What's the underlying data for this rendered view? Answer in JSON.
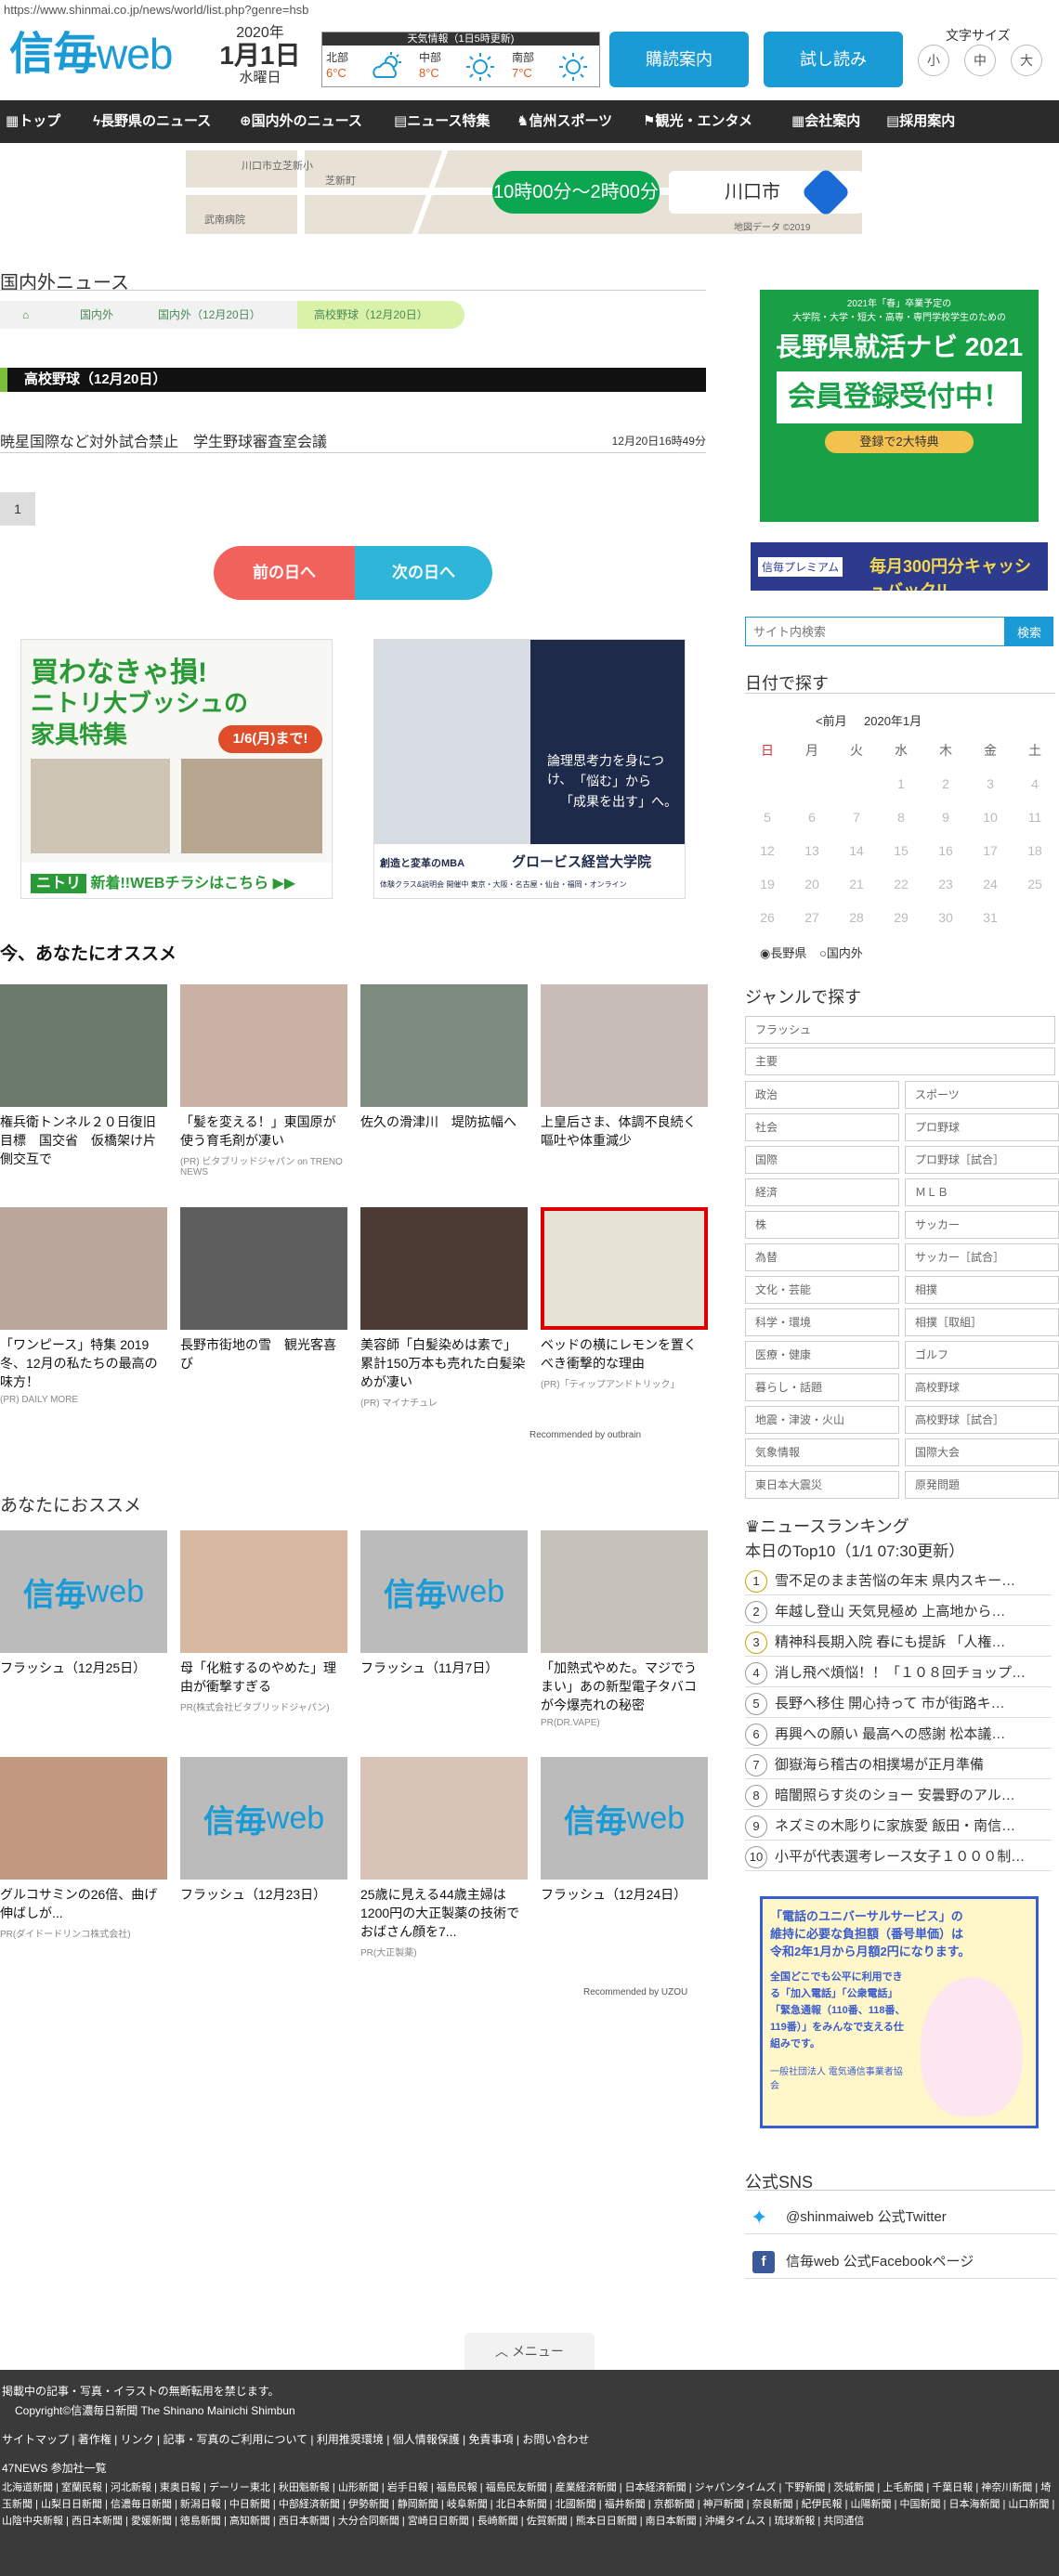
{
  "url": "https://www.shinmai.co.jp/news/world/list.php?genre=hsb",
  "logo": {
    "main": "信毎",
    "sub": "web"
  },
  "date": {
    "year": "2020年",
    "day": "1月1日",
    "weekday": "水曜日"
  },
  "weather": {
    "title": "天気情報（1日5時更新)",
    "areas": [
      {
        "name": "北部",
        "temp": "6°C",
        "icon": "cloud-sun-icon"
      },
      {
        "name": "中部",
        "temp": "8°C",
        "icon": "sun-icon"
      },
      {
        "name": "南部",
        "temp": "7°C",
        "icon": "sun-icon"
      }
    ]
  },
  "header_buttons": {
    "subscribe": "購読案内",
    "trial": "試し読み"
  },
  "font_size": {
    "label": "文字サイズ",
    "small": "小",
    "medium": "中",
    "large": "大"
  },
  "nav": [
    "トップ",
    "長野県のニュース",
    "国内外のニュース",
    "ニュース特集",
    "信州スポーツ",
    "観光・エンタメ",
    "会社案内",
    "採用案内"
  ],
  "map_ad": {
    "time": "10時00分～2時00分",
    "city": "川口市",
    "credit": "地図データ ©2019",
    "label1": "川口市立芝新小",
    "label2": "芝新町",
    "label3": "武南病院"
  },
  "section_title": "国内外ニュース",
  "breadcrumb": [
    "国内外",
    "国内外（12月20日）",
    "高校野球（12月20日）"
  ],
  "category": "高校野球（12月20日）",
  "news": [
    {
      "title": "暁星国際など対外試合禁止　学生野球審査室会議",
      "time": "12月20日16時49分"
    }
  ],
  "page": "1",
  "day_nav": {
    "prev": "前の日へ",
    "next": "次の日へ"
  },
  "ads": {
    "nitori": {
      "title": "買わなきゃ損!",
      "title2": "ニトリ大ブッシュの",
      "title3": "家具特集",
      "until": "1/6(月)まで!",
      "brand": "ニトリ",
      "footer": "新着!!WEBチラシはこちら ▶▶"
    },
    "globis": {
      "copy1": "論理思考力を身につけ、",
      "copy2": "「悩む」から",
      "copy3": "「成果を出す」へ。",
      "brand": "グロービス経営大学院",
      "tag": "創造と変革のMBA",
      "footer": "体験クラス&説明会 開催中 東京・大阪・名古屋・仙台・福岡・オンライン"
    }
  },
  "recommend": {
    "heading": "今、あなたにオススメ",
    "credit": "Recommended by outbrain",
    "items": [
      {
        "title": "権兵衛トンネル２０日復旧目標　国交省　仮橋架け片側交互で",
        "pr": "",
        "bg": "#6b7a6a"
      },
      {
        "title": "「髪を変える！」東国原が使う育毛剤が凄い",
        "pr": "(PR) ビタブリッドジャパン on TRENO NEWS",
        "bg": "#c9b2a3"
      },
      {
        "title": "佐久の滑津川　堤防拡幅へ",
        "pr": "",
        "bg": "#7d8a80"
      },
      {
        "title": "上皇后さま、体調不良続く　嘔吐や体重減少",
        "pr": "",
        "bg": "#c8bdb6"
      },
      {
        "title": "「ワンピース」特集 2019冬、12月の私たちの最高の味方！",
        "pr": "(PR) DAILY MORE",
        "bg": "#b9a79b"
      },
      {
        "title": "長野市街地の雪　観光客喜び",
        "pr": "",
        "bg": "#5e5e5e"
      },
      {
        "title": "美容師「白髪染めは素で」累計150万本も売れた白髪染めが凄い",
        "pr": "(PR) マイナチュレ",
        "bg": "#4d3b36"
      },
      {
        "title": "ベッドの横にレモンを置くべき衝撃的な理由",
        "pr": "(PR)「ティップアンドトリック」",
        "bg": "#e7e2d6"
      }
    ]
  },
  "recommend2": {
    "heading": "あなたにおススメ",
    "credit": "Recommended by UZOU",
    "items": [
      {
        "title": "フラッシュ（12月25日）",
        "pr": "",
        "type": "logo"
      },
      {
        "title": "母「化粧するのやめた」理由が衝撃すぎる",
        "pr": "PR(株式会社ビタブリッドジャパン)",
        "type": "photo",
        "bg": "#d9b8a2"
      },
      {
        "title": "フラッシュ（11月7日）",
        "pr": "",
        "type": "logo"
      },
      {
        "title": "「加熱式やめた。マジでうまい」あの新型電子タバコが今爆売れの秘密",
        "pr": "PR(DR.VAPE)",
        "type": "photo",
        "bg": "#c6c2bb"
      },
      {
        "title": "グルコサミンの26倍、曲げ伸ばしが...",
        "pr": "PR(ダイドードリンコ株式会社)",
        "type": "photo",
        "bg": "#c29a80"
      },
      {
        "title": "フラッシュ（12月23日）",
        "pr": "",
        "type": "logo"
      },
      {
        "title": "25歳に見える44歳主婦は1200円の大正製薬の技術でおばさん顔を7...",
        "pr": "PR(大正製薬)",
        "type": "photo",
        "bg": "#d8c4b6"
      },
      {
        "title": "フラッシュ（12月24日）",
        "pr": "",
        "type": "logo"
      }
    ]
  },
  "side": {
    "recruit": {
      "l1": "2021年「春」卒業予定の",
      "l2": "大学院・大学・短大・高専・専門学校学生のための",
      "title": "長野県就活ナビ 2021",
      "big": "会員登録受付中！",
      "benefit": "登録で2大特典"
    },
    "premium": {
      "brand": "信毎プレミアム",
      "copy": "毎月300円分キャッシュバック!!"
    },
    "search": {
      "placeholder": "サイト内検索",
      "button": "検索"
    },
    "calendar": {
      "heading": "日付で探す",
      "prev": "<前月",
      "month": "2020年1月",
      "days": [
        "日",
        "月",
        "火",
        "水",
        "木",
        "金",
        "土"
      ],
      "weeks": [
        [
          "",
          "",
          "",
          "1",
          "2",
          "3",
          "4"
        ],
        [
          "5",
          "6",
          "7",
          "8",
          "9",
          "10",
          "11"
        ],
        [
          "12",
          "13",
          "14",
          "15",
          "16",
          "17",
          "18"
        ],
        [
          "19",
          "20",
          "21",
          "22",
          "23",
          "24",
          "25"
        ],
        [
          "26",
          "27",
          "28",
          "29",
          "30",
          "31",
          ""
        ]
      ],
      "radio1": "長野県",
      "radio2": "国内外"
    },
    "genre": {
      "heading": "ジャンルで探す",
      "top": [
        "フラッシュ",
        "主要"
      ],
      "grid": [
        [
          "政治",
          "スポーツ"
        ],
        [
          "社会",
          "プロ野球"
        ],
        [
          "国際",
          "プロ野球［試合］"
        ],
        [
          "経済",
          "ＭＬＢ"
        ],
        [
          "株",
          "サッカー"
        ],
        [
          "為替",
          "サッカー［試合］"
        ],
        [
          "文化・芸能",
          "相撲"
        ],
        [
          "科学・環境",
          "相撲［取組］"
        ],
        [
          "医療・健康",
          "ゴルフ"
        ],
        [
          "暮らし・話題",
          "高校野球"
        ],
        [
          "地震・津波・火山",
          "高校野球［試合］"
        ],
        [
          "気象情報",
          "国際大会"
        ],
        [
          "東日本大震災",
          "原発問題"
        ]
      ]
    },
    "ranking": {
      "heading": "ニュースランキング",
      "sub": "本日のTop10（1/1 07:30更新）",
      "items": [
        "雪不足のまま苦悩の年末 県内スキー…",
        "年越し登山 天気見極め 上高地から…",
        "精神科長期入院 春にも提訴 「人権…",
        "消し飛べ煩悩！！「１０８回チョップ…",
        "長野へ移住 開心持って 市が街路キ…",
        "再興への願い 最高への感謝 松本議…",
        "御嶽海ら稽古の相撲場が正月準備",
        "暗闇照らす炎のショー 安曇野のアル…",
        "ネズミの木彫りに家族愛 飯田・南信…",
        "小平が代表選考レース女子１０００制…"
      ]
    },
    "universal": {
      "l1": "「電話のユニバーサルサービス」の",
      "l2": "維持に必要な負担額（番号単価）は",
      "l3": "令和2年1月から月額2円になります。",
      "body": "全国どこでも公平に利用できる「加入電話」「公衆電話」「緊急通報（110番、118番、119番）」をみんなで支える仕組みです。",
      "org": "一般社団法人 電気通信事業者協会"
    },
    "sns": {
      "heading": "公式SNS",
      "twitter": "@shinmaiweb 公式Twitter",
      "facebook": "信毎web 公式Facebookページ"
    }
  },
  "menu": "メニュー",
  "footer": {
    "notice": "掲載中の記事・写真・イラストの無断転用を禁じます。",
    "copyright": "Copyright©信濃毎日新聞 The Shinano Mainichi Shimbun",
    "links": [
      "サイトマップ",
      "著作権",
      "リンク",
      "記事・写真のご利用について",
      "利用推奨環境",
      "個人情報保護",
      "免責事項",
      "お問い合わせ"
    ],
    "news47": "47NEWS 参加社一覧",
    "papers": "北海道新聞 | 室蘭民報 | 河北新報 | 東奥日報 | デーリー東北 | 秋田魁新報 | 山形新聞 | 岩手日報 | 福島民報 | 福島民友新聞 | 産業経済新聞 | 日本経済新聞 | ジャパンタイムズ | 下野新聞 | 茨城新聞 | 上毛新聞 | 千葉日報 | 神奈川新聞 | 埼玉新聞 | 山梨日日新聞 | 信濃毎日新聞 | 新潟日報 | 中日新聞 | 中部経済新聞 | 伊勢新聞 | 静岡新聞 | 岐阜新聞 | 北日本新聞 | 北國新聞 | 福井新聞 | 京都新聞 | 神戸新聞 | 奈良新聞 | 紀伊民報 | 山陽新聞 | 中国新聞 | 日本海新聞 | 山口新聞 | 山陰中央新報 | 西日本新聞 | 愛媛新聞 | 徳島新聞 | 高知新聞 | 西日本新聞 | 大分合同新聞 | 宮崎日日新聞 | 長崎新聞 | 佐賀新聞 | 熊本日日新聞 | 南日本新聞 | 沖縄タイムス | 琉球新報 | 共同通信"
  }
}
